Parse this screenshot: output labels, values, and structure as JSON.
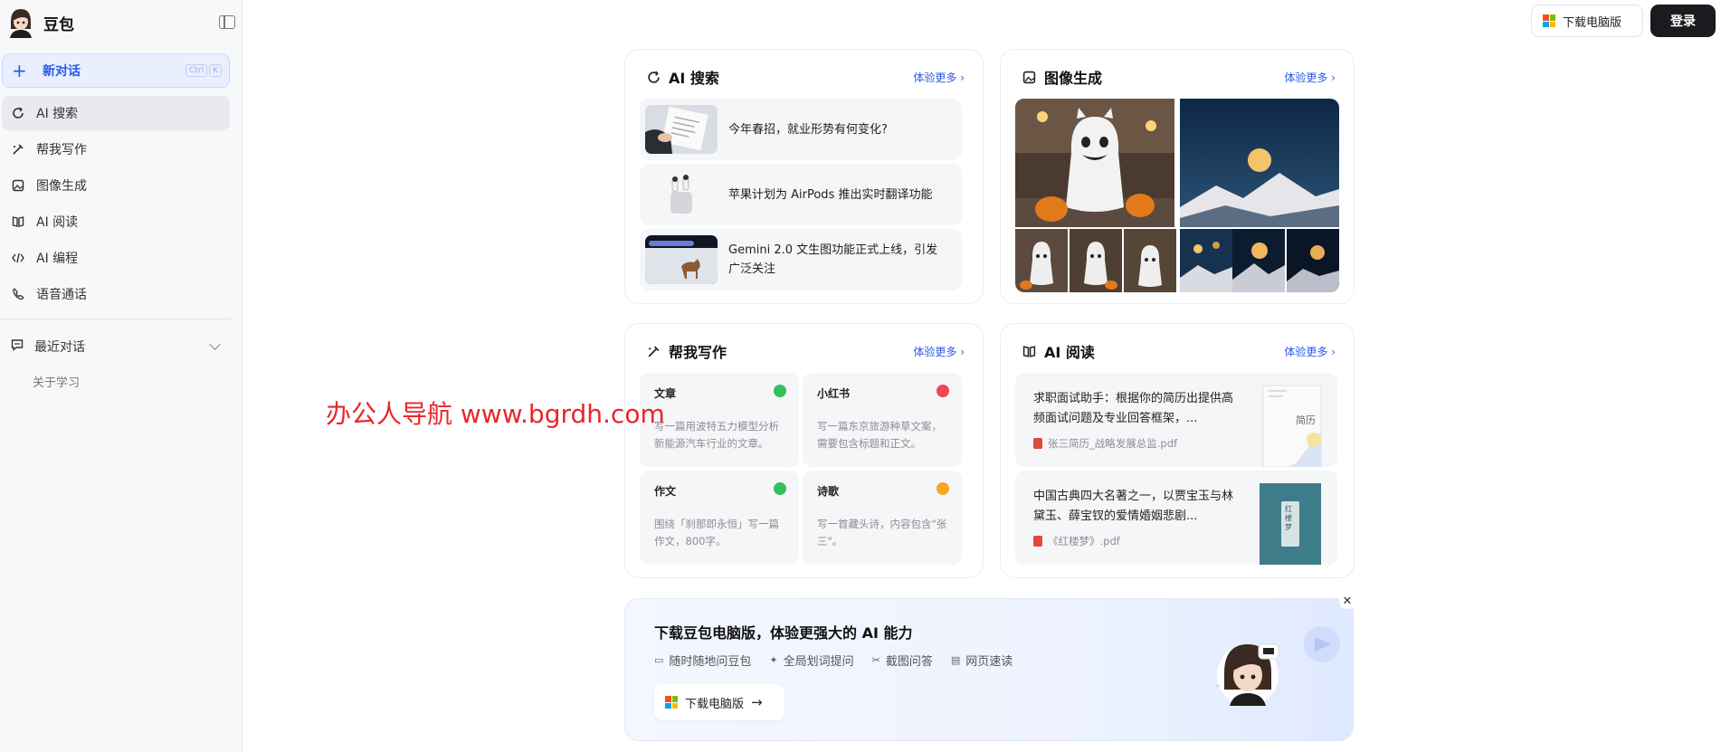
{
  "sidebar": {
    "brand": "豆包",
    "new_chat": {
      "label": "新对话",
      "shortcut": [
        "Ctrl",
        "K"
      ]
    },
    "nav": [
      {
        "label": "AI 搜索",
        "icon": "search-refresh-icon"
      },
      {
        "label": "帮我写作",
        "icon": "pen-icon"
      },
      {
        "label": "图像生成",
        "icon": "image-icon"
      },
      {
        "label": "AI 阅读",
        "icon": "book-icon"
      },
      {
        "label": "AI 编程",
        "icon": "code-icon"
      },
      {
        "label": "语音通话",
        "icon": "phone-icon"
      }
    ],
    "recent": {
      "label": "最近对话",
      "icon": "chat-icon"
    },
    "history": [
      "关于学习"
    ]
  },
  "topbar": {
    "download_label": "下载电脑版",
    "login_label": "登录"
  },
  "cards": {
    "search": {
      "title": "AI 搜索",
      "more": "体验更多 ›",
      "items": [
        "今年春招，就业形势有何变化?",
        "苹果计划为 AirPods 推出实时翻译功能",
        "Gemini 2.0 文生图功能正式上线，引发广泛关注"
      ]
    },
    "image": {
      "title": "图像生成",
      "more": "体验更多 ›"
    },
    "writing": {
      "title": "帮我写作",
      "more": "体验更多 ›",
      "items": [
        {
          "title": "文章",
          "desc": "写一篇用波特五力模型分析新能源汽车行业的文章。",
          "color": "#34c05a"
        },
        {
          "title": "小红书",
          "desc": "写一篇东京旅游种草文案，需要包含标题和正文。",
          "color": "#f04653"
        },
        {
          "title": "作文",
          "desc": "围绕「刹那即永恒」写一篇作文，800字。",
          "color": "#34c05a"
        },
        {
          "title": "诗歌",
          "desc": "写一首藏头诗，内容包含\"张三\"。",
          "color": "#f5a623"
        }
      ]
    },
    "reading": {
      "title": "AI 阅读",
      "more": "体验更多 ›",
      "items": [
        {
          "desc": "求职面试助手：根据你的简历出提供高频面试问题及专业回答框架，...",
          "file": "张三简历_战略发展总监.pdf",
          "thumb_text": "简历"
        },
        {
          "desc": "中国古典四大名著之一，以贾宝玉与林黛玉、薛宝钗的爱情婚姻悲剧...",
          "file": "《红楼梦》.pdf",
          "thumb_text": "红楼梦"
        }
      ]
    }
  },
  "promo": {
    "title": "下载豆包电脑版，体验更强大的 AI 能力",
    "features": [
      {
        "label": "随时随地问豆包",
        "icon": "chat-icon"
      },
      {
        "label": "全局划词提问",
        "icon": "sparkle-icon"
      },
      {
        "label": "截图问答",
        "icon": "scissors-icon"
      },
      {
        "label": "网页速读",
        "icon": "doc-icon"
      }
    ],
    "button": "下载电脑版"
  },
  "watermark": "办公人导航 www.bgrdh.com",
  "colors": {
    "accent": "#2b58e6",
    "dark_button": "#1b1b1f"
  }
}
